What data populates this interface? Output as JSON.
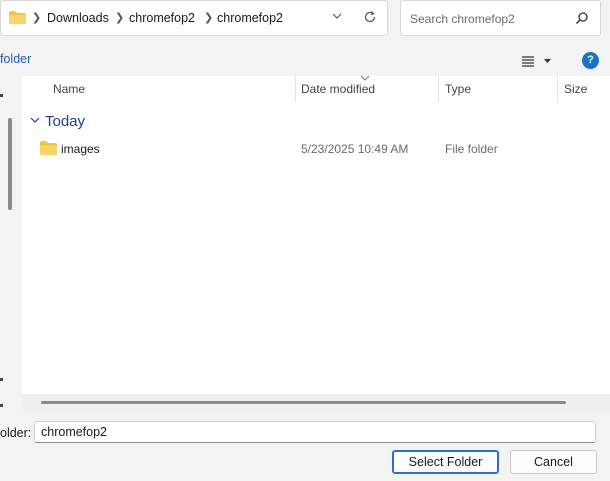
{
  "address_bar": {
    "breadcrumbs": [
      "Downloads",
      "chromefop2",
      "chromefop2"
    ]
  },
  "search": {
    "placeholder": "Search chromefop2"
  },
  "toolbar": {
    "left_label": "folder",
    "help_glyph": "?"
  },
  "columns": [
    "Name",
    "Date modified",
    "Type",
    "Size"
  ],
  "group": {
    "label": "Today"
  },
  "files": [
    {
      "name": "images",
      "date_modified": "5/23/2025 10:49 AM",
      "type": "File folder",
      "icon": "folder-icon"
    }
  ],
  "folder_field": {
    "label": "older:",
    "value": "chromefop2"
  },
  "buttons": {
    "select": "Select Folder",
    "cancel": "Cancel"
  },
  "colors": {
    "accent": "#2a6fc9",
    "group_text": "#1d3f8f",
    "folder_yellow": "#f5c342",
    "help": "#1a73c7"
  }
}
